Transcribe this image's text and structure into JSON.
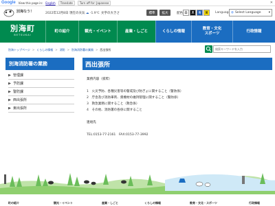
{
  "translate_bar": {
    "logo": "Google",
    "view_text": "View this page in:",
    "language": "English",
    "translate": "Translate",
    "turn_off": "Turn off for: Japanese"
  },
  "header": {
    "slogan": "別海なう！",
    "weather": "2022年12月8日 現在の天気",
    "temperature": "-1.9℃",
    "fontsize_label": "文字の大きさ",
    "btn_standard": "標準",
    "btn_zoom": "拡大",
    "color_label": "配色",
    "swatches": [
      "白",
      "黒",
      "青",
      "黄"
    ],
    "language_label": "Language",
    "select_language": "Select Language"
  },
  "nav": {
    "logo": "別海町",
    "logo_roman": "BETSUKAI",
    "items": [
      "町の紹介",
      "観光・イベント",
      "産業・しごと",
      "くらしの情報",
      "教育・文化\nスポーツ",
      "行政情報"
    ]
  },
  "breadcrumb": [
    "別海トップページ",
    "くらしの情報",
    "消防",
    "別海消防署の業務",
    "西出張所"
  ],
  "search": {
    "placeholder": "検索キーワードを入力"
  },
  "sidebar": {
    "title": "別海消防署の業務",
    "items": [
      "管理課",
      "予防課",
      "警防課",
      "西出張所",
      "東出張所"
    ]
  },
  "content": {
    "title": "西出張所",
    "intro": "業務内容（抜粋）",
    "duties": [
      "1　火災予防、各種災害等の警戒及び防ぎょに関すること（警防係）",
      "2　庁舎及び消防車両、資機材の維持管理に関すること（警防係）",
      "3　救急業務に関すること（救急係）",
      "4　その他、消防署の各係に関すること"
    ],
    "contact_label": "連絡先",
    "contact": "TEL:0153-77-2161　FAX:0153-77-3992"
  },
  "footer": {
    "items": [
      "町の紹介",
      "観光・イベント",
      "産業・しごと",
      "くらしの情報",
      "教育・文化・スポーツ",
      "行政情報"
    ]
  },
  "colors": {
    "green": "#008a4f",
    "blue": "#1b6dc1"
  }
}
